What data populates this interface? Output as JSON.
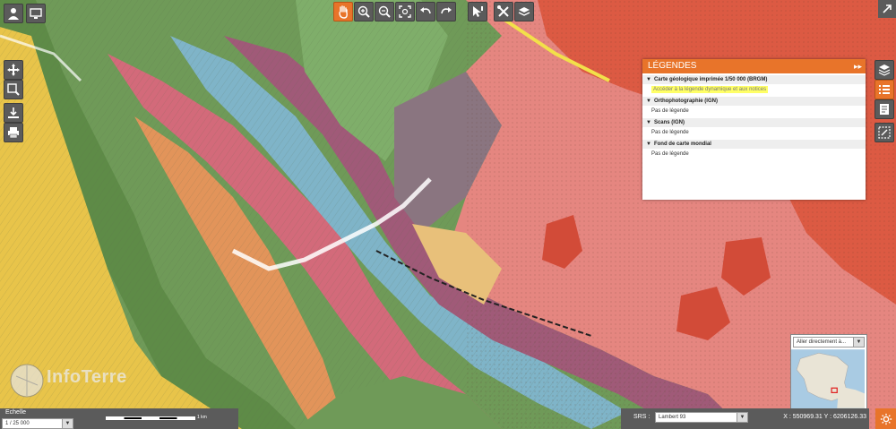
{
  "logo": {
    "text": "InfoTerre"
  },
  "legend": {
    "title": "LÉGENDES",
    "collapse_glyph": "▸▸",
    "sections": [
      {
        "title": "Carte géologique imprimée 1/50 000 (BRGM)",
        "link": "Accéder à la légende dynamique et aux notices"
      },
      {
        "title": "Orthophotographie (IGN)",
        "text": "Pas de légende"
      },
      {
        "title": "Scans (IGN)",
        "text": "Pas de légende"
      },
      {
        "title": "Fond de carte mondial",
        "text": "Pas de légende"
      }
    ]
  },
  "scale": {
    "label": "Echelle",
    "value": "1 / 25 000",
    "bar_label": "1 km"
  },
  "srs": {
    "label": "SRS :",
    "value": "Lambert 93"
  },
  "coords": {
    "text": "X : 550969.31 Y : 6206126.33"
  },
  "minimap": {
    "goto_placeholder": "Aller directement à..."
  },
  "colors": {
    "accent": "#e8742a",
    "toolbar": "#5b5b5b",
    "highlight": "#ffff66"
  }
}
